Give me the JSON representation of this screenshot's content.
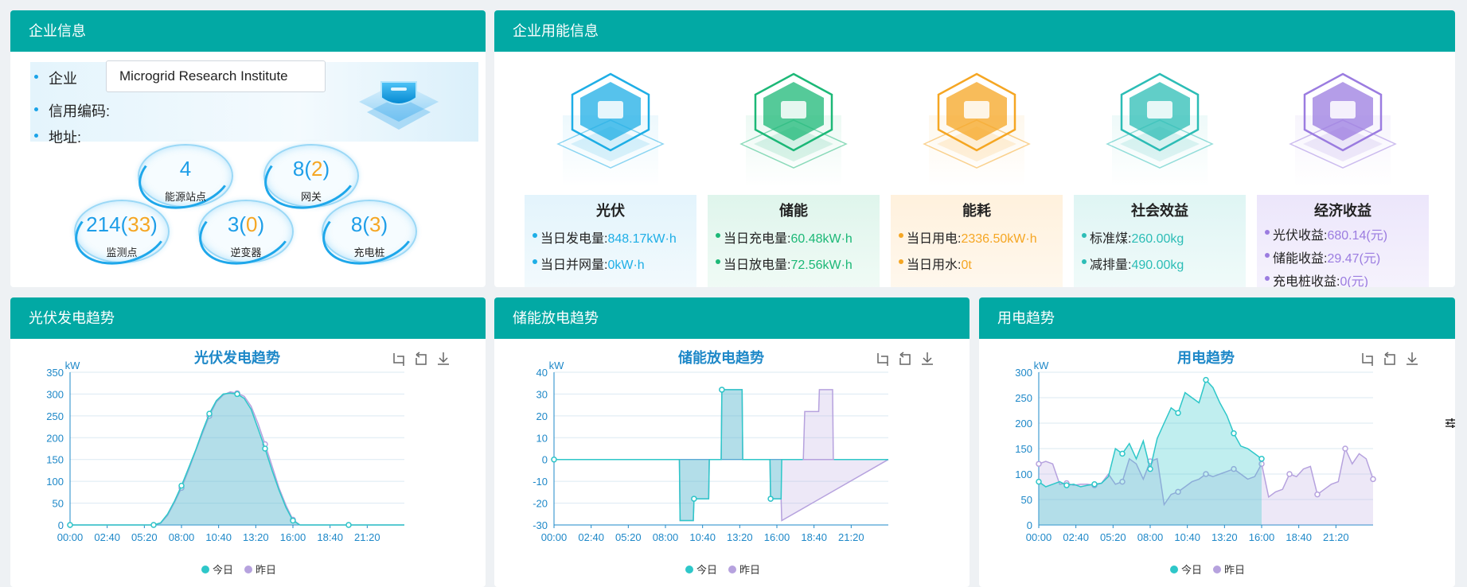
{
  "company": {
    "title": "企业信息",
    "label_company": "企业",
    "company_value": "Microgrid Research Institute",
    "label_credit": "信用编码:",
    "label_address": "地址:",
    "stats": [
      {
        "num": "4",
        "extra": "",
        "label": "能源站点"
      },
      {
        "num": "8",
        "extra": "2",
        "label": "网关"
      },
      {
        "num": "214",
        "extra": "33",
        "label": "监测点"
      },
      {
        "num": "3",
        "extra": "0",
        "label": "逆变器"
      },
      {
        "num": "8",
        "extra": "3",
        "label": "充电桩"
      }
    ]
  },
  "energy": {
    "title": "企业用能信息",
    "cards": [
      {
        "icon": "solar-panel-icon",
        "title": "光伏",
        "color": "#1eaee6",
        "lines": [
          {
            "k": "当日发电量:",
            "v": "848.17kW·h"
          },
          {
            "k": "当日并网量:",
            "v": "0kW·h"
          }
        ]
      },
      {
        "icon": "battery-icon",
        "title": "储能",
        "color": "#1cb877",
        "lines": [
          {
            "k": "当日充电量:",
            "v": "60.48kW·h"
          },
          {
            "k": "当日放电量:",
            "v": "72.56kW·h"
          }
        ]
      },
      {
        "icon": "lightning-icon",
        "title": "能耗",
        "color": "#f5a623",
        "lines": [
          {
            "k": "当日用电:",
            "v": "2336.50kW·h"
          },
          {
            "k": "当日用水:",
            "v": "0t"
          }
        ]
      },
      {
        "icon": "plant-hand-icon",
        "title": "社会效益",
        "color": "#2cbdb6",
        "lines": [
          {
            "k": "标准煤:",
            "v": "260.00kg"
          },
          {
            "k": "减排量:",
            "v": "490.00kg"
          }
        ]
      },
      {
        "icon": "money-bag-icon",
        "title": "经济收益",
        "color": "#9b7ce0",
        "lines": [
          {
            "k": "光伏收益:",
            "v": "680.14(元)"
          },
          {
            "k": "储能收益:",
            "v": "29.47(元)"
          },
          {
            "k": "充电桩收益:",
            "v": "0(元)"
          }
        ]
      }
    ]
  },
  "charts_panels": {
    "pv_title": "光伏发电趋势",
    "storage_title": "储能放电趋势",
    "usage_title": "用电趋势",
    "legend_today": "今日",
    "legend_yesterday": "昨日",
    "colors": {
      "today": "#2ec7c9",
      "yesterday": "#b6a2de"
    }
  },
  "chart_data": [
    {
      "type": "area",
      "title": "光伏发电趋势",
      "ylabel": "kW",
      "ylim": [
        0,
        350
      ],
      "yticks": [
        0,
        50,
        100,
        150,
        200,
        250,
        300,
        350
      ],
      "xticks": [
        "00:00",
        "02:40",
        "05:20",
        "08:00",
        "10:40",
        "13:20",
        "16:00",
        "18:40",
        "21:20"
      ],
      "x_hours": [
        0,
        2,
        4,
        5,
        6,
        6.5,
        7,
        7.5,
        8,
        8.5,
        9,
        9.5,
        10,
        10.5,
        11,
        11.5,
        12,
        12.5,
        13,
        13.5,
        14,
        14.5,
        15,
        15.5,
        16,
        16.5,
        17,
        18,
        20,
        22,
        24
      ],
      "series": [
        {
          "name": "今日",
          "values": [
            0,
            0,
            0,
            0,
            0,
            5,
            25,
            55,
            90,
            130,
            170,
            215,
            255,
            285,
            300,
            302,
            300,
            290,
            265,
            220,
            175,
            125,
            80,
            40,
            10,
            0,
            0,
            0,
            0,
            0,
            0
          ]
        },
        {
          "name": "昨日",
          "values": [
            0,
            0,
            0,
            0,
            0,
            4,
            22,
            52,
            85,
            125,
            168,
            210,
            250,
            282,
            298,
            305,
            302,
            295,
            272,
            232,
            185,
            135,
            85,
            45,
            12,
            0,
            0,
            0,
            0,
            0,
            0
          ]
        }
      ]
    },
    {
      "type": "area",
      "title": "储能放电趋势",
      "ylabel": "kW",
      "ylim": [
        -30,
        40
      ],
      "yticks": [
        -30,
        -20,
        -10,
        0,
        10,
        20,
        30,
        40
      ],
      "xticks": [
        "00:00",
        "02:40",
        "05:20",
        "08:00",
        "10:40",
        "13:20",
        "16:00",
        "18:40",
        "21:20"
      ],
      "x_hours": [
        0,
        9.0,
        9.05,
        10.0,
        10.05,
        11.1,
        11.15,
        12.0,
        12.05,
        13.5,
        13.55,
        15.5,
        15.55,
        16.3,
        16.35,
        24
      ],
      "series": [
        {
          "name": "今日",
          "values": [
            0,
            0,
            -28,
            -28,
            -18,
            -18,
            0,
            0,
            32,
            32,
            0,
            0,
            -18,
            -18,
            0,
            0
          ]
        },
        {
          "name": "昨日",
          "values": [
            0,
            0,
            -28,
            -28,
            -18,
            -18,
            0,
            0,
            32,
            32,
            0,
            0,
            -18,
            -18,
            -28,
            0
          ]
        }
      ],
      "extra_yesterday": {
        "x_hours": [
          17.9,
          18.0,
          19.0,
          19.05,
          20.0,
          20.05
        ],
        "values": [
          0,
          22,
          22,
          32,
          32,
          0
        ]
      }
    },
    {
      "type": "area",
      "title": "用电趋势",
      "ylabel": "kW",
      "ylim": [
        0,
        300
      ],
      "yticks": [
        0,
        50,
        100,
        150,
        200,
        250,
        300
      ],
      "xticks": [
        "00:00",
        "02:40",
        "05:20",
        "08:00",
        "10:40",
        "13:20",
        "16:00",
        "18:40",
        "21:20"
      ],
      "x_hours": [
        0,
        0.5,
        1,
        1.5,
        2,
        2.5,
        3,
        3.5,
        4,
        4.5,
        5,
        5.5,
        6,
        6.5,
        7,
        7.5,
        8,
        8.5,
        9,
        9.5,
        10,
        10.5,
        11,
        11.5,
        12,
        12.5,
        13,
        13.5,
        14,
        14.5,
        15,
        15.5,
        16,
        16.5,
        17,
        17.5,
        18,
        18.5,
        19,
        19.5,
        20,
        20.5,
        21,
        21.5,
        22,
        22.5,
        23,
        23.5,
        24
      ],
      "series": [
        {
          "name": "今日",
          "values": [
            85,
            75,
            80,
            85,
            78,
            80,
            75,
            78,
            80,
            82,
            95,
            150,
            140,
            160,
            130,
            165,
            110,
            170,
            200,
            230,
            220,
            260,
            250,
            240,
            285,
            270,
            240,
            215,
            180,
            155,
            150,
            140,
            130,
            null,
            null,
            null,
            null,
            null,
            null,
            null,
            null,
            null,
            null,
            null,
            null,
            null,
            null,
            null,
            null
          ]
        },
        {
          "name": "昨日",
          "values": [
            120,
            125,
            120,
            80,
            82,
            78,
            80,
            80,
            78,
            82,
            100,
            80,
            85,
            130,
            120,
            90,
            125,
            130,
            40,
            60,
            65,
            75,
            85,
            90,
            100,
            95,
            100,
            105,
            110,
            100,
            90,
            95,
            120,
            55,
            65,
            70,
            100,
            95,
            110,
            115,
            60,
            70,
            80,
            85,
            150,
            120,
            140,
            130,
            90
          ]
        }
      ]
    }
  ]
}
